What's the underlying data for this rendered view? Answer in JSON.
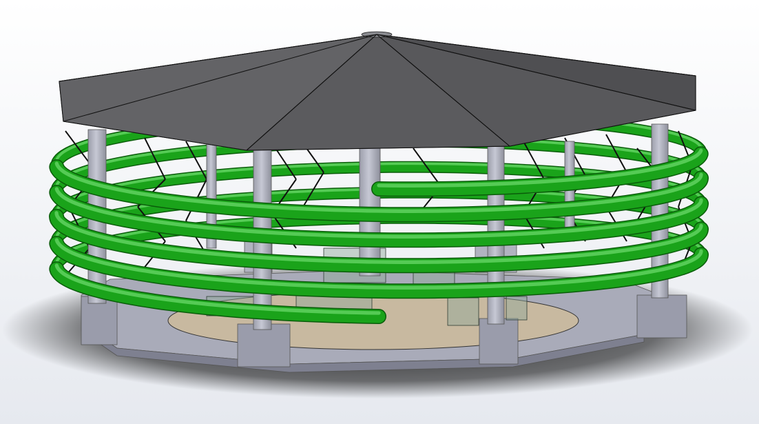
{
  "viewport": {
    "background": {
      "top": "#ffffff",
      "bottom": "#e6e9ef"
    },
    "shadow_color": "#1a1a1a"
  },
  "model": {
    "roof": {
      "sides": 8,
      "fill": "#5a5a5c",
      "edge": "#111111"
    },
    "columns": {
      "count": 8,
      "fill": "#b4b6c4",
      "shade": "#8e909c"
    },
    "base": {
      "fill": "#a6a8b6",
      "shade": "#7e8090",
      "floor_color": "#c8b9a0"
    },
    "spiral_tube": {
      "turns": 5,
      "color": "#1aa31a",
      "highlight": "#6fdc6f",
      "dark": "#0a5c0a"
    },
    "struts": {
      "color": "#111111"
    },
    "glass_tanks": {
      "color": "#8fa89a"
    }
  }
}
